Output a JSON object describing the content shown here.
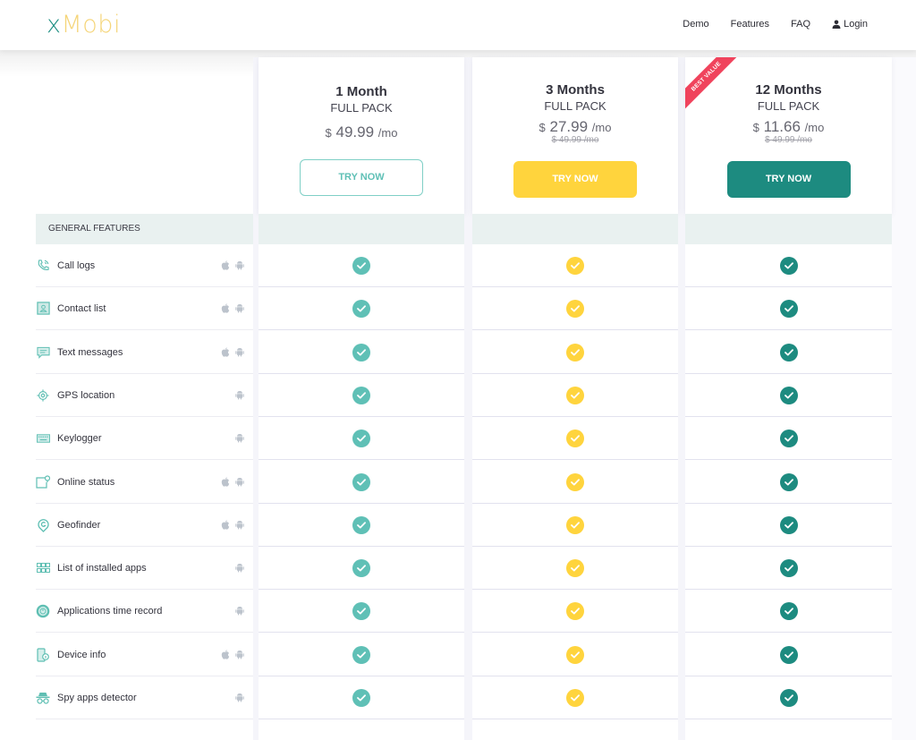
{
  "header": {
    "logo": {
      "x": "x",
      "rest": "Mobi"
    },
    "nav": [
      {
        "label": "Demo"
      },
      {
        "label": "Features"
      },
      {
        "label": "FAQ"
      },
      {
        "label": "Login",
        "icon": "user-icon"
      }
    ]
  },
  "colors": {
    "teal_light": "#5fc0b6",
    "yellow": "#ffd43d",
    "teal_dark": "#1d8b80",
    "badge_red": "#f0435c",
    "section_bg": "#e9f1f0"
  },
  "plans": [
    {
      "title": "1 Month",
      "subtitle": "FULL PACK",
      "currency": "$",
      "price": "49.99",
      "per": "/mo",
      "old_price": "",
      "button": "TRY NOW",
      "style": "outline",
      "badge": ""
    },
    {
      "title": "3 Months",
      "subtitle": "FULL PACK",
      "currency": "$",
      "price": "27.99",
      "per": "/mo",
      "old_price": "$ 49.99 /mo",
      "button": "TRY NOW",
      "style": "yellow",
      "badge": ""
    },
    {
      "title": "12 Months",
      "subtitle": "FULL PACK",
      "currency": "$",
      "price": "11.66",
      "per": "/mo",
      "old_price": "$ 49.99 /mo",
      "button": "TRY NOW",
      "style": "teal",
      "badge": "BEST VALUE"
    }
  ],
  "section": {
    "label": "GENERAL FEATURES"
  },
  "features": [
    {
      "label": "Call logs",
      "icon": "phone-icon",
      "ios": true,
      "android": true,
      "included": [
        true,
        true,
        true
      ]
    },
    {
      "label": "Contact list",
      "icon": "contact-card-icon",
      "ios": true,
      "android": true,
      "included": [
        true,
        true,
        true
      ]
    },
    {
      "label": "Text messages",
      "icon": "message-icon",
      "ios": true,
      "android": true,
      "included": [
        true,
        true,
        true
      ]
    },
    {
      "label": "GPS location",
      "icon": "target-icon",
      "ios": false,
      "android": true,
      "included": [
        true,
        true,
        true
      ]
    },
    {
      "label": "Keylogger",
      "icon": "keyboard-icon",
      "ios": false,
      "android": true,
      "included": [
        true,
        true,
        true
      ]
    },
    {
      "label": "Online status",
      "icon": "online-status-icon",
      "ios": true,
      "android": true,
      "included": [
        true,
        true,
        true
      ]
    },
    {
      "label": "Geofinder",
      "icon": "map-pin-icon",
      "ios": true,
      "android": true,
      "included": [
        true,
        true,
        true
      ]
    },
    {
      "label": "List of installed apps",
      "icon": "apps-grid-icon",
      "ios": false,
      "android": true,
      "included": [
        true,
        true,
        true
      ]
    },
    {
      "label": "Applications time record",
      "icon": "clock-icon",
      "ios": false,
      "android": true,
      "included": [
        true,
        true,
        true
      ]
    },
    {
      "label": "Device info",
      "icon": "device-info-icon",
      "ios": true,
      "android": true,
      "included": [
        true,
        true,
        true
      ]
    },
    {
      "label": "Spy apps detector",
      "icon": "spy-icon",
      "ios": false,
      "android": true,
      "included": [
        true,
        true,
        true
      ]
    }
  ]
}
